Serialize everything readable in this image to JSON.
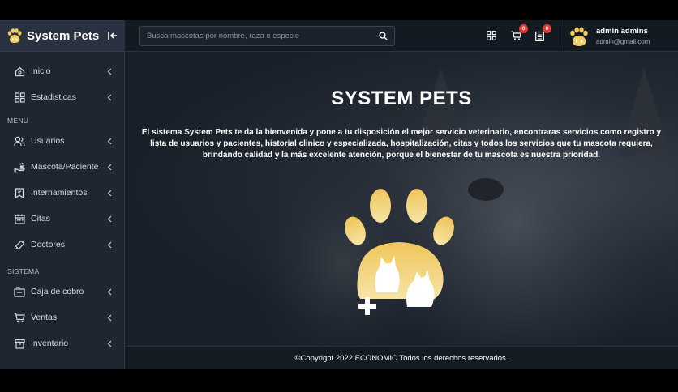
{
  "brand": {
    "title": "System Pets",
    "logo_icon": "paw-icon",
    "collapse_icon": "collapse-sidebar-icon"
  },
  "search": {
    "placeholder": "Busca mascotas por nombre, raza o especie",
    "icon": "search-icon"
  },
  "topbar": {
    "grid_icon": "apps-grid-icon",
    "cart": {
      "icon": "cart-icon",
      "count": "0"
    },
    "list": {
      "icon": "clipboard-list-icon",
      "count": "0"
    }
  },
  "user": {
    "name": "admin admins",
    "email": "admin@gmail.com",
    "avatar_icon": "paw-avatar-icon"
  },
  "sidebar": {
    "top_items": [
      {
        "label": "Inicio",
        "icon": "home-icon"
      },
      {
        "label": "Estadisticas",
        "icon": "dashboard-icon"
      }
    ],
    "menu_title": "MENU",
    "menu_items": [
      {
        "label": "Usuarios",
        "icon": "users-icon"
      },
      {
        "label": "Mascota/Paciente",
        "icon": "pet-hand-icon"
      },
      {
        "label": "Internamientos",
        "icon": "bookmark-icon"
      },
      {
        "label": "Citas",
        "icon": "calendar-icon"
      },
      {
        "label": "Doctores",
        "icon": "syringe-icon"
      }
    ],
    "system_title": "SISTEMA",
    "system_items": [
      {
        "label": "Caja de cobro",
        "icon": "cash-register-icon"
      },
      {
        "label": "Ventas",
        "icon": "cart-icon"
      },
      {
        "label": "Inventario",
        "icon": "archive-icon"
      }
    ]
  },
  "hero": {
    "title": "SYSTEM PETS",
    "text": "El sistema System Pets te da la bienvenida y pone a tu disposición el mejor servicio veterinario, encontraras servicios como registro y lista de usuarios y pacientes, historial clinico y especializada, hospitalización, citas y todos los servicios que tu mascota requiera, brindando calidad y la más excelente atención, porque el bienestar de tu mascota es nuestra prioridad."
  },
  "footer": {
    "text": "©Copyright 2022 ECONOMIC Todos los derechos reservados."
  },
  "colors": {
    "accent": "#f2cd66",
    "badge": "#e53935",
    "sidebar": "#1f2632",
    "topbar": "#141a22"
  }
}
